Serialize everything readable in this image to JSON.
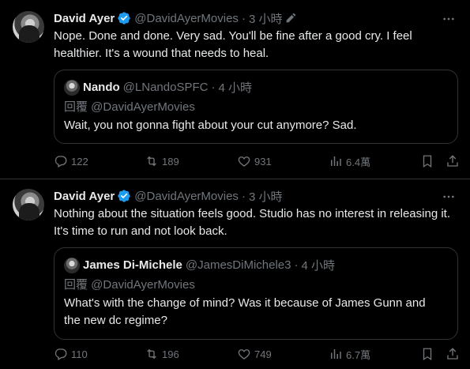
{
  "tweets": [
    {
      "author": "David Ayer",
      "handle": "@DavidAyerMovies",
      "dot": "·",
      "time": "3 小時",
      "text": "Nope. Done and done.  Very sad. You'll be fine after a good cry. I feel healthier. It's a wound that needs to heal.",
      "quote": {
        "author": "Nando",
        "handle": "@LNandoSPFC",
        "dot": "·",
        "time": "4 小時",
        "reply_to": "回覆 @DavidAyerMovies",
        "text": "Wait, you not gonna fight about your cut anymore? Sad."
      },
      "stats": {
        "replies": "122",
        "retweets": "189",
        "likes": "931",
        "views": "6.4萬"
      }
    },
    {
      "author": "David Ayer",
      "handle": "@DavidAyerMovies",
      "dot": "·",
      "time": "3 小時",
      "text": "Nothing about the situation feels good. Studio has no interest in releasing it. It's time to run and not look back.",
      "quote": {
        "author": "James Di-Michele",
        "handle": "@JamesDiMichele3",
        "dot": "·",
        "time": "4 小時",
        "reply_to": "回覆 @DavidAyerMovies",
        "text": "What's with the change of mind? Was it because of James Gunn and the new dc regime?"
      },
      "stats": {
        "replies": "110",
        "retweets": "196",
        "likes": "749",
        "views": "6.7萬"
      }
    }
  ],
  "colors": {
    "background": "#000000",
    "text": "#e7e9ea",
    "muted": "#71767b",
    "border": "#2f3336",
    "verified": "#1d9bf0"
  },
  "icons": [
    "verified-badge-icon",
    "edit-icon",
    "more-icon",
    "reply-icon",
    "retweet-icon",
    "like-icon",
    "views-icon",
    "bookmark-icon",
    "share-icon"
  ]
}
